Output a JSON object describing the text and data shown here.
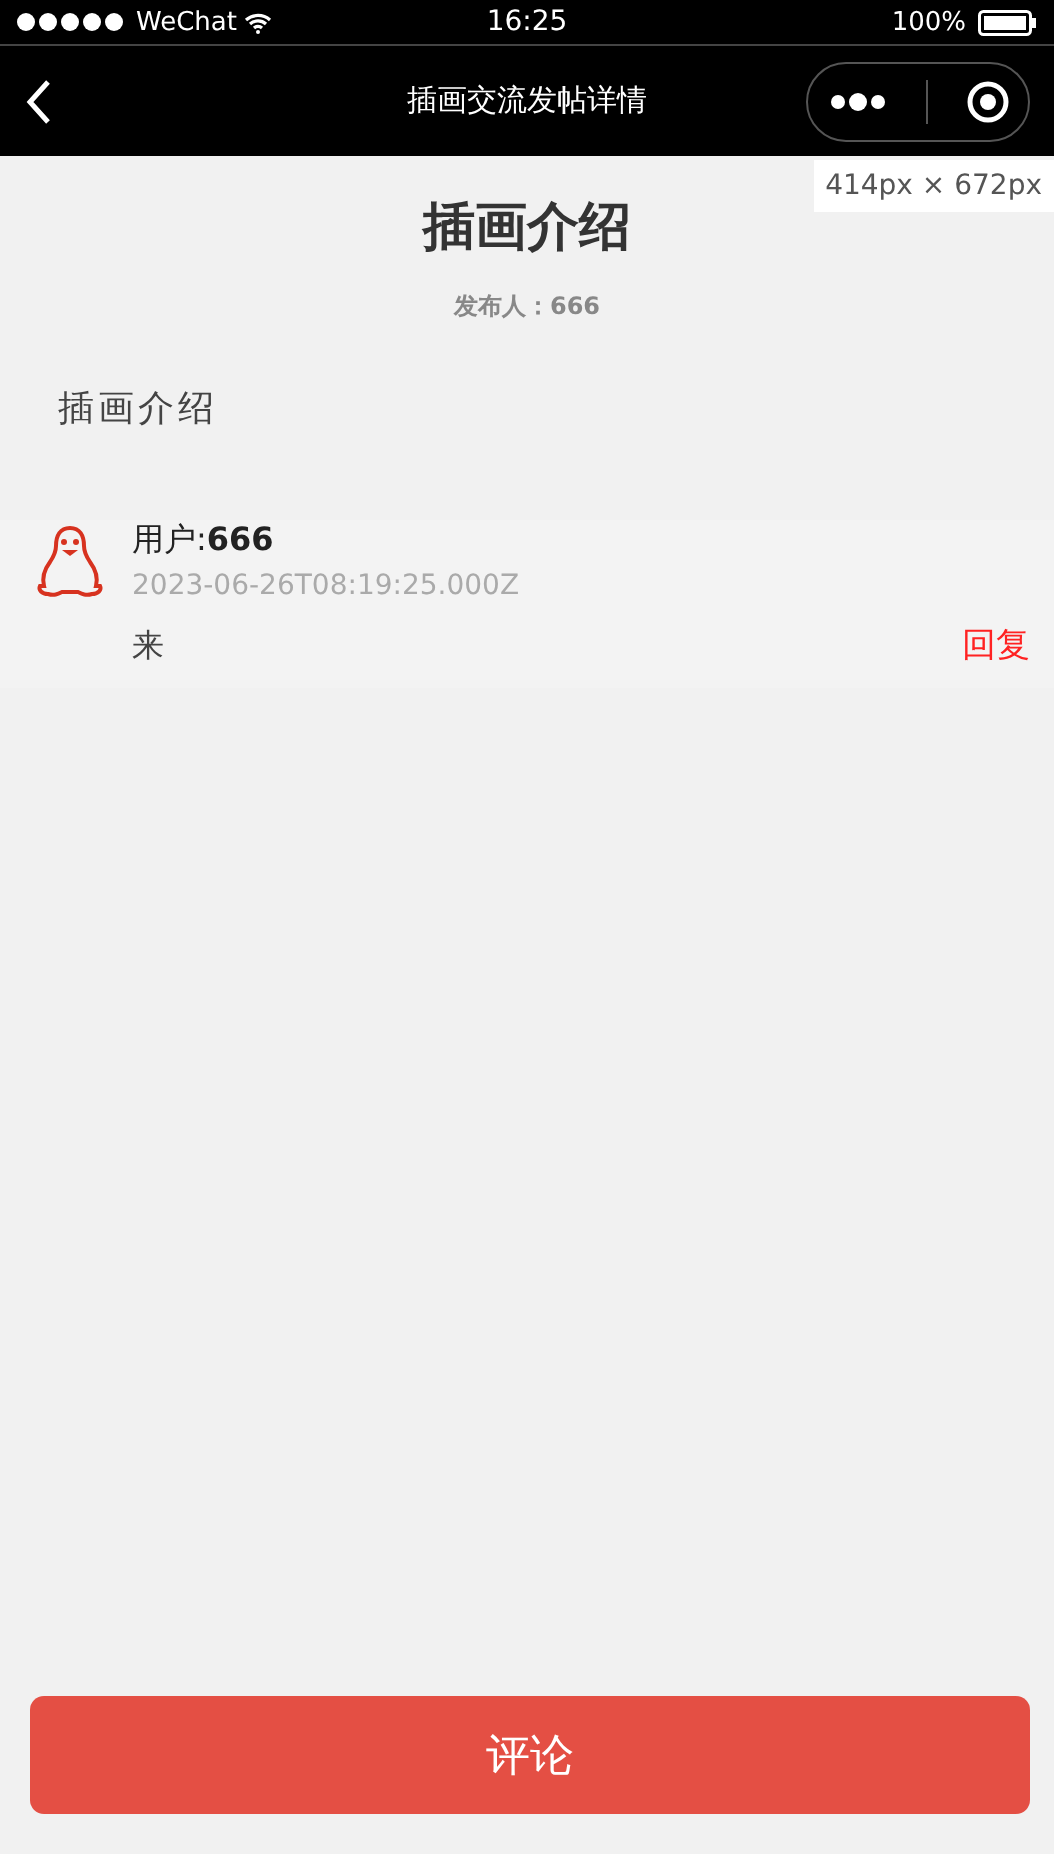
{
  "status_bar": {
    "carrier": "WeChat",
    "time": "16:25",
    "battery": "100%"
  },
  "nav_bar": {
    "title": "插画交流发帖详情"
  },
  "size_overlay": "414px × 672px",
  "post": {
    "title": "插画介绍",
    "author": "发布人：666",
    "body": "插画介绍"
  },
  "comments": [
    {
      "user_label": "用户:",
      "user": "666",
      "time": "2023-06-26T08:19:25.000Z",
      "text": "来",
      "reply": "回复"
    }
  ],
  "comment_button": "评论"
}
